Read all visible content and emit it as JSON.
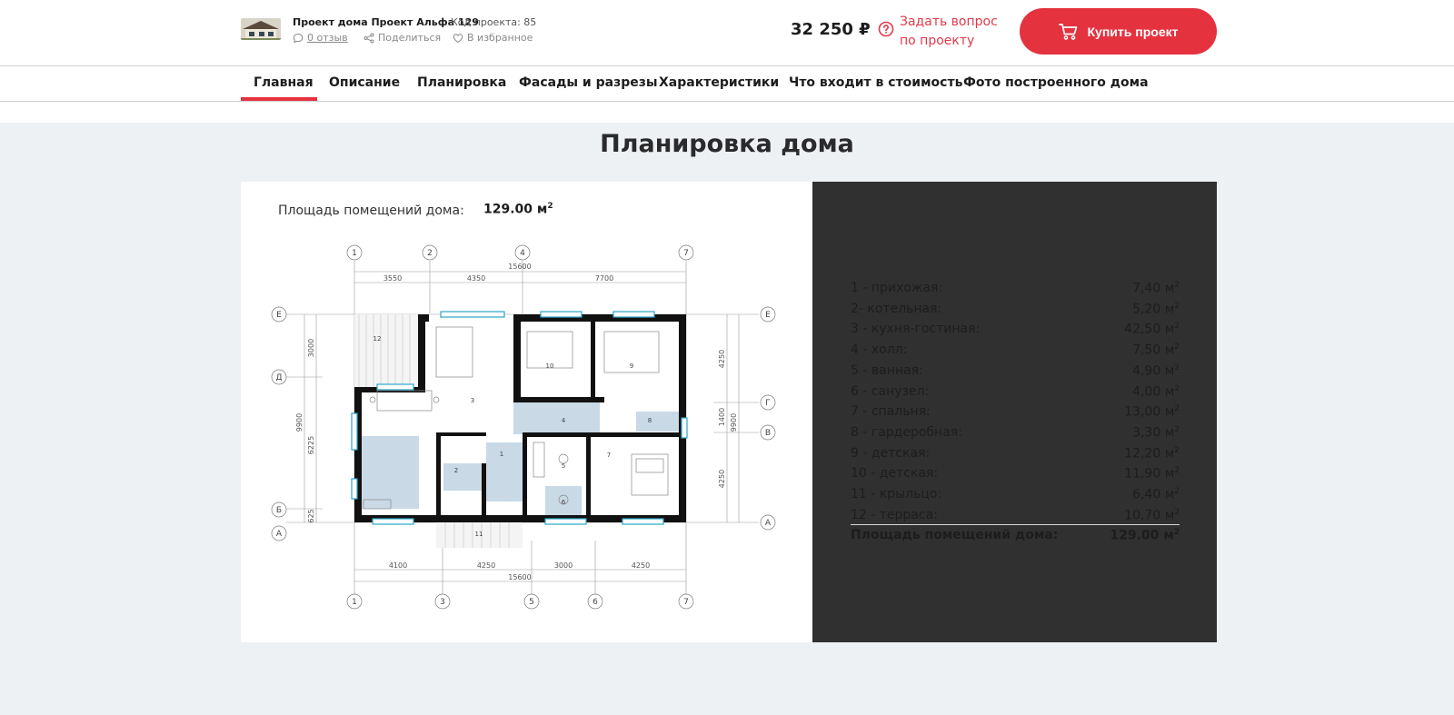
{
  "header": {
    "project_title": "Проект дома Проект Альфа 129",
    "project_code": "Код проекта: 85",
    "reviews": "0 отзыв",
    "share": "Поделиться",
    "favorite": "В избранное",
    "price": "32 250 ₽",
    "ask_line1": "Задать вопрос",
    "ask_line2": "по проекту",
    "buy_label": "Купить проект",
    "accent": "#e5323f"
  },
  "tabs": [
    {
      "label": "Главная",
      "active": true
    },
    {
      "label": "Описание"
    },
    {
      "label": "Планировка"
    },
    {
      "label": "Фасады и разрезы"
    },
    {
      "label": "Характеристики"
    },
    {
      "label": "Что входит в стоимость"
    },
    {
      "label": "Фото построенного дома"
    }
  ],
  "plan_section": {
    "title": "Планировка дома",
    "area_label": "Площадь помещений дома:",
    "area_value": "129.00 м",
    "area_sup": "2"
  },
  "drawing": {
    "axis_top": [
      "1",
      "2",
      "4",
      "7"
    ],
    "axis_bottom": [
      "1",
      "3",
      "5",
      "6",
      "7"
    ],
    "axis_left": [
      "Е",
      "Д",
      "Б",
      "А"
    ],
    "axis_right": [
      "Е",
      "Г",
      "В",
      "А"
    ],
    "dims_top_total": "15600",
    "dims_top": [
      "3550",
      "4350",
      "7700"
    ],
    "dims_bottom": [
      "4100",
      "4250",
      "3000",
      "4250"
    ],
    "dims_bottom_total": "15600",
    "dims_left": [
      "3000",
      "9900",
      "6225",
      "625"
    ],
    "dims_right": [
      "4250",
      "1400",
      "9900",
      "4250"
    ]
  },
  "rooms": [
    {
      "name": "1 - прихожая:",
      "area": "7,40 м"
    },
    {
      "name": "2- котельная:",
      "area": "5,20 м"
    },
    {
      "name": "3 - кухня-гостиная:",
      "area": "42,50 м"
    },
    {
      "name": "4 - холл:",
      "area": "7,50 м"
    },
    {
      "name": "5 - ванная:",
      "area": "4,90 м"
    },
    {
      "name": "6 - санузел:",
      "area": "4,00 м"
    },
    {
      "name": "7 - спальня:",
      "area": "13,00 м"
    },
    {
      "name": "8 - гардеробная:",
      "area": "3,30 м"
    },
    {
      "name": "9 - детская:",
      "area": "12,20 м"
    },
    {
      "name": "10 - детская:",
      "area": "11,90 м"
    },
    {
      "name": "11 - крыльцо:",
      "area": "6,40 м"
    },
    {
      "name": "12 - терраса:",
      "area": "10,70 м"
    }
  ],
  "total": {
    "name": "Площадь помещений дома:",
    "area": "129.00 м"
  },
  "sup": "2"
}
